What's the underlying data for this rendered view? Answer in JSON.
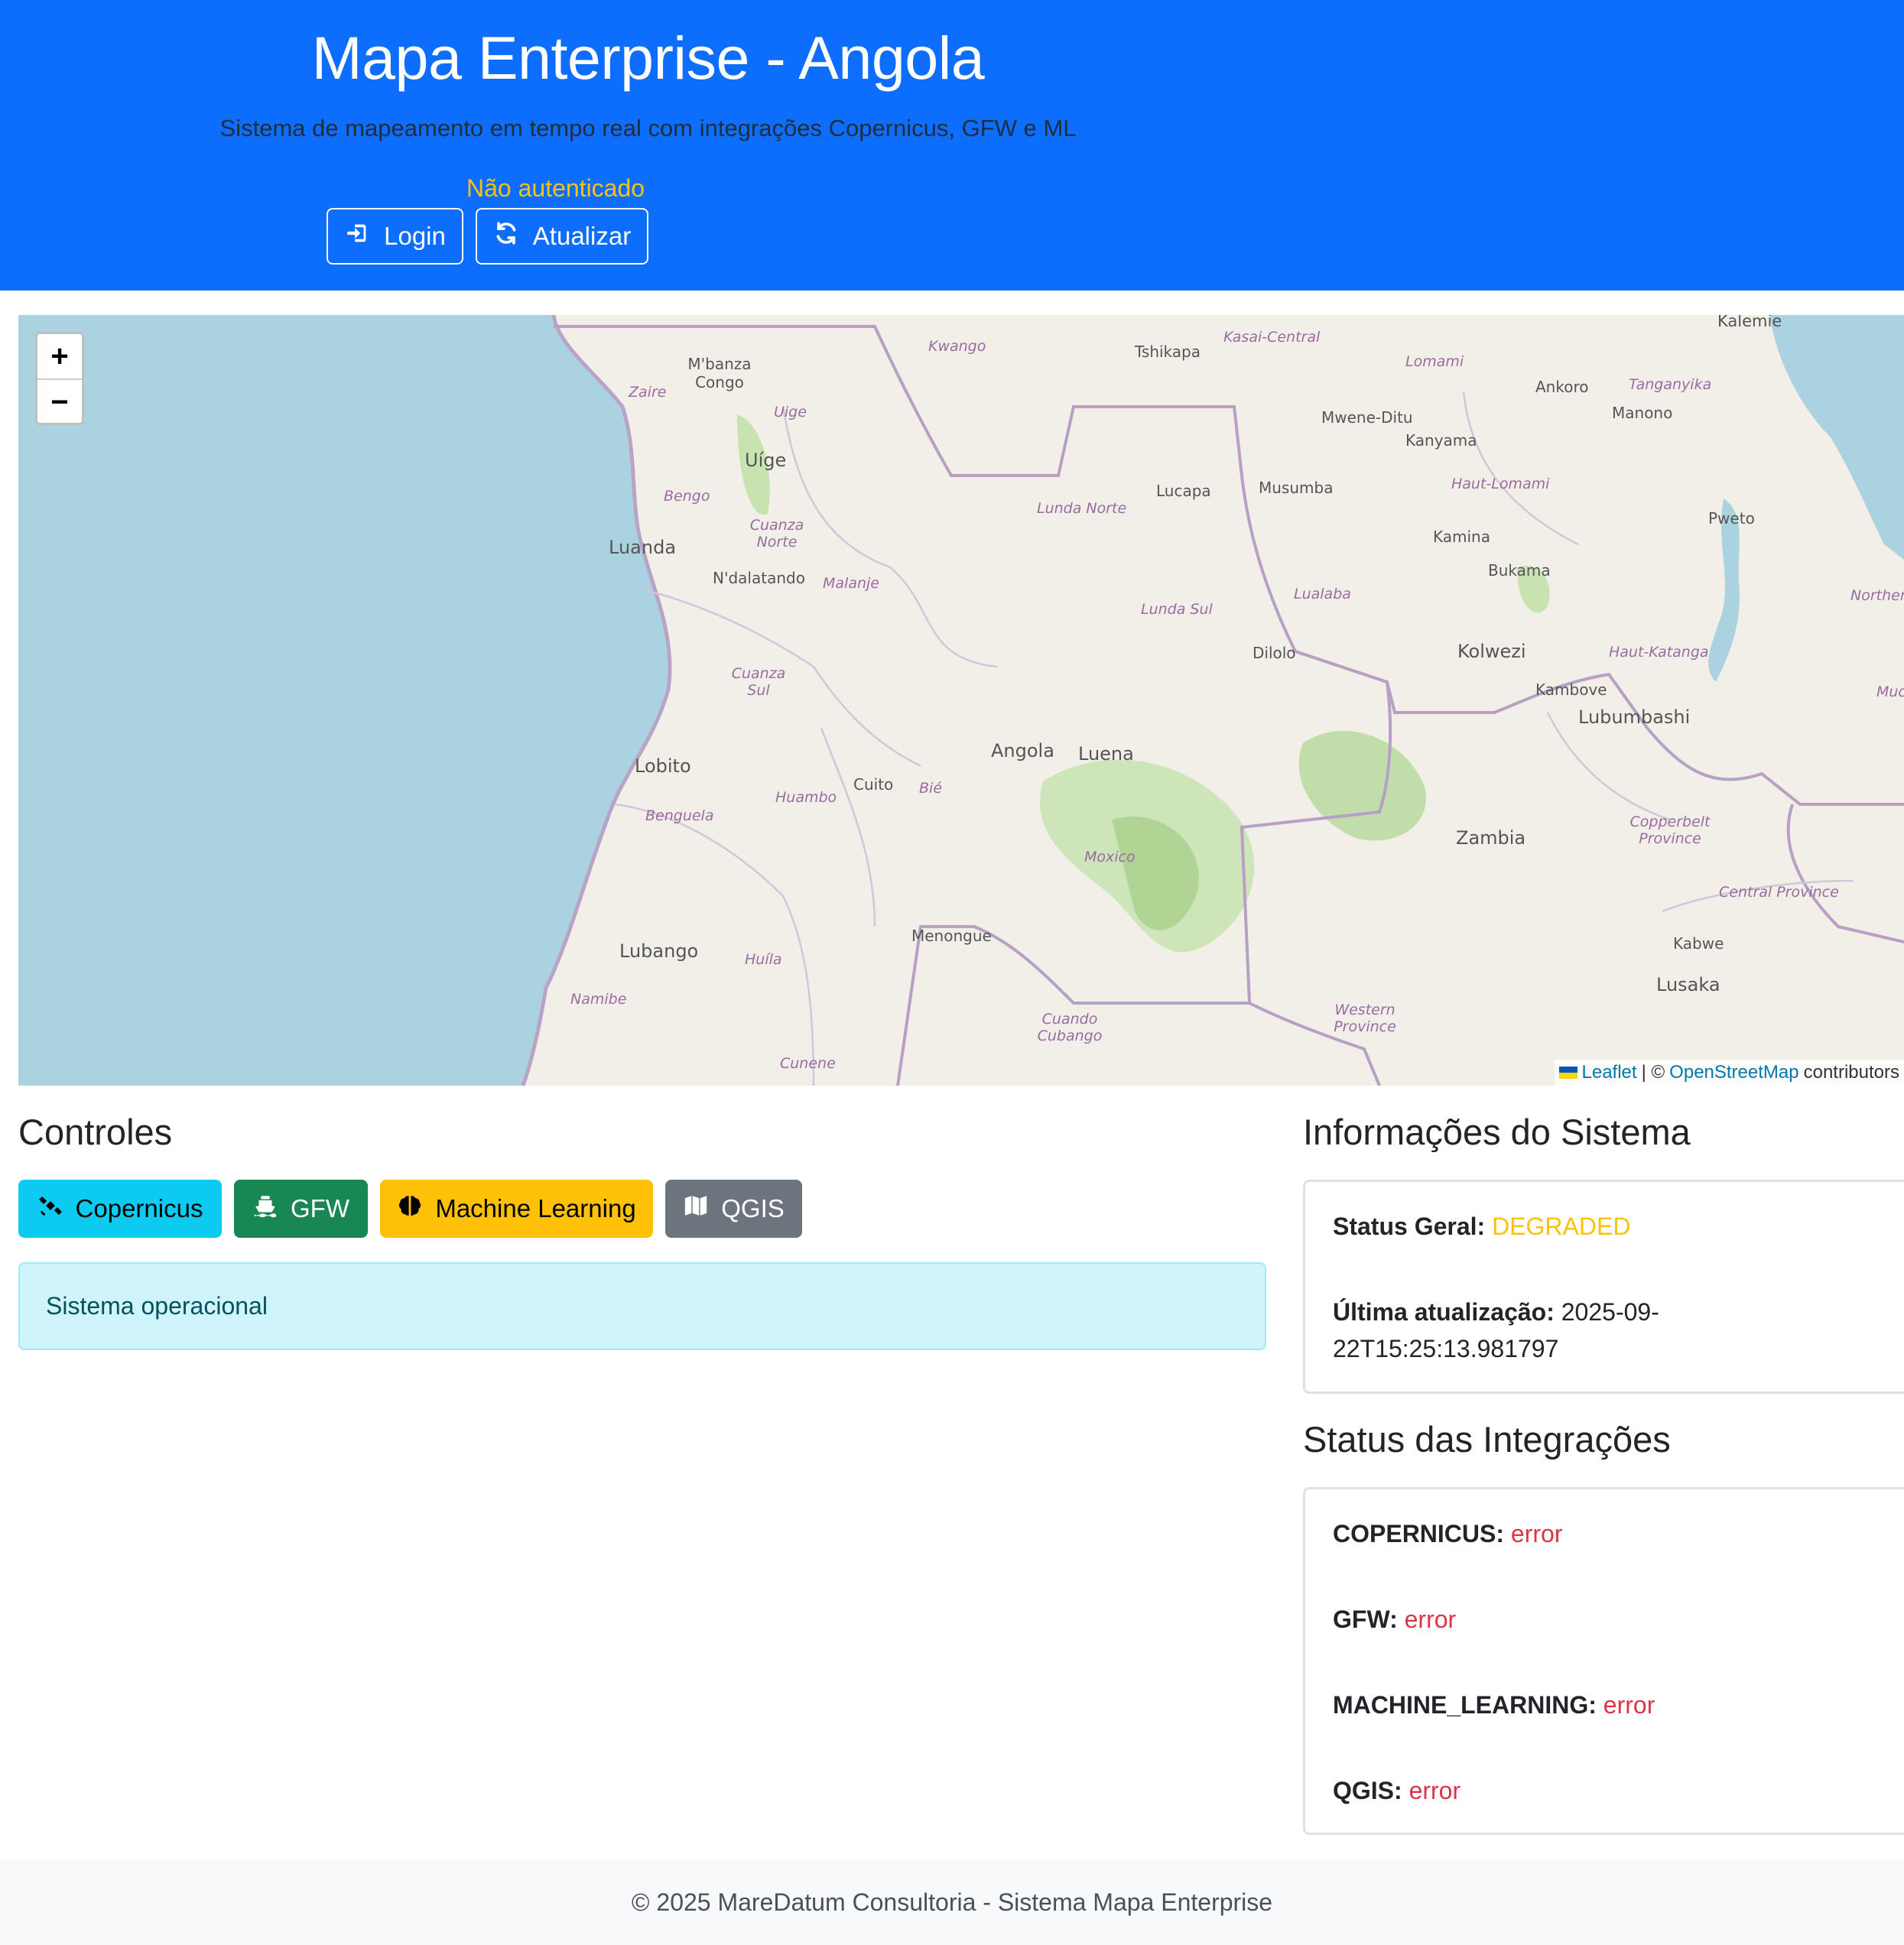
{
  "header": {
    "title": "Mapa Enterprise - Angola",
    "subtitle": "Sistema de mapeamento em tempo real com integrações Copernicus, GFW e ML",
    "auth_status": "Não autenticado",
    "login_label": "Login",
    "refresh_label": "Atualizar",
    "login_icon": "sign-in-icon",
    "refresh_icon": "refresh-icon",
    "bg_color": "#0d6efd",
    "auth_color": "#ffc107"
  },
  "map": {
    "zoom_in": "+",
    "zoom_out": "−",
    "attribution": {
      "leaflet": "Leaflet",
      "separator": "| ©",
      "osm": "OpenStreetMap",
      "suffix": "contributors"
    },
    "places": [
      "Kalemie",
      "Kasai-Central",
      "Tshikapa",
      "Kwango",
      "M'banza Congo",
      "Zaire",
      "Uige",
      "Uíge",
      "Lomami",
      "Tanganyika",
      "Ankoro",
      "Manono",
      "Mwene-Ditu",
      "Kanyama",
      "Haut-Lomami",
      "Lucapa",
      "Musumba",
      "Lunda Norte",
      "Bengo",
      "Cuanza Norte",
      "Luanda",
      "N'dalatando",
      "Malanje",
      "Kamina",
      "Bukama",
      "Pweto",
      "Lualaba",
      "Lunda Sul",
      "Dilolo",
      "Kolwezi",
      "Haut-Katanga",
      "Kambove",
      "Lubumbashi",
      "Cuanza Sul",
      "Angola",
      "Luena",
      "Lobito",
      "Cuito",
      "Bié",
      "Huambo",
      "Benguela",
      "Moxico",
      "Zambia",
      "Copperbelt Province",
      "Central Province",
      "Menongue",
      "Lubango",
      "Huíla",
      "Kabwe",
      "Lusaka",
      "Namibe",
      "Western Province",
      "Cuando Cubango",
      "Cunene",
      "Northern Province",
      "Muchinga Province"
    ]
  },
  "controls": {
    "heading": "Controles",
    "buttons": [
      {
        "label": "Copernicus",
        "icon": "satellite-icon",
        "color": "#0dcaf0"
      },
      {
        "label": "GFW",
        "icon": "ship-icon",
        "color": "#198754"
      },
      {
        "label": "Machine Learning",
        "icon": "brain-icon",
        "color": "#ffc107"
      },
      {
        "label": "QGIS",
        "icon": "map-icon",
        "color": "#6c757d"
      }
    ],
    "alert": "Sistema operacional"
  },
  "system_info": {
    "heading": "Informações do Sistema",
    "status_label": "Status Geral:",
    "status_value": "DEGRADED",
    "updated_label": "Última atualização:",
    "updated_value_1": "2025-09-",
    "updated_value_2": "22T15:25:13.981797"
  },
  "integrations": {
    "heading": "Status das Integrações",
    "items": [
      {
        "name": "COPERNICUS:",
        "status": "error"
      },
      {
        "name": "GFW:",
        "status": "error"
      },
      {
        "name": "MACHINE_LEARNING:",
        "status": "error"
      },
      {
        "name": "QGIS:",
        "status": "error"
      }
    ],
    "error_color": "#dc3545"
  },
  "footer": {
    "text": "© 2025 MareDatum Consultoria - Sistema Mapa Enterprise"
  }
}
